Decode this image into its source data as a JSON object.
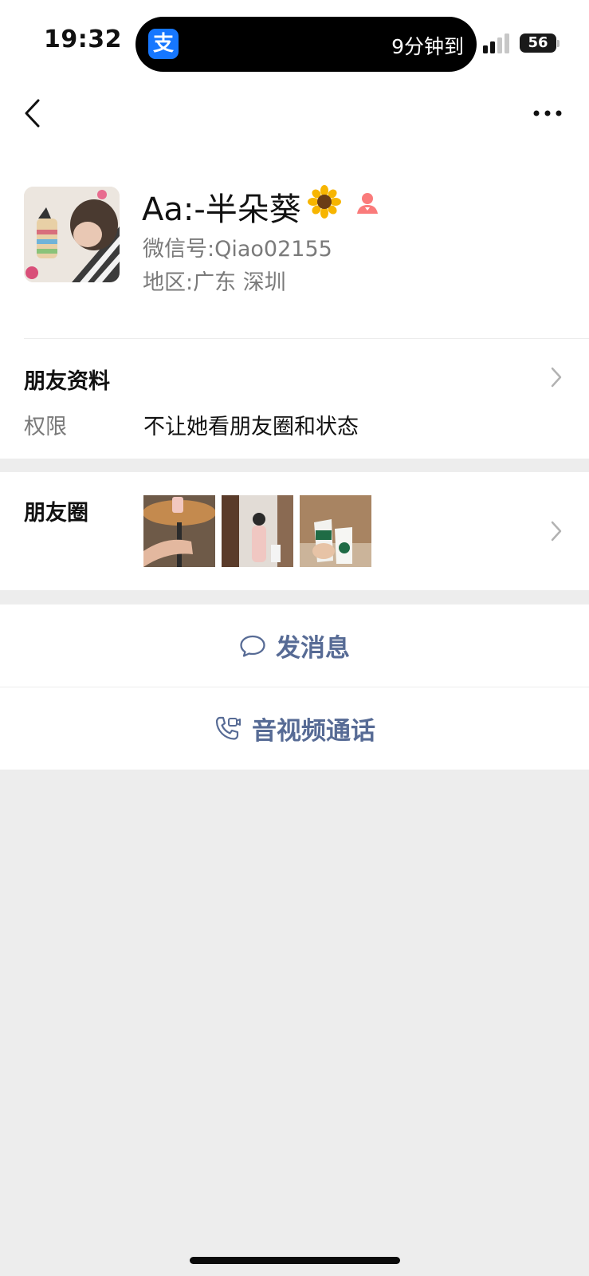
{
  "status_bar": {
    "time": "19:32",
    "island_app_icon": "alipay-icon",
    "island_app_glyph": "支",
    "island_text": "9分钟到",
    "battery": "56"
  },
  "nav": {
    "back_icon": "chevron-left-icon",
    "more_icon": "ellipsis-icon"
  },
  "profile": {
    "name": "Aa:-半朵葵",
    "name_emoji": "🌻",
    "gender_icon": "female-icon",
    "wechat_id_label": "微信号:",
    "wechat_id": "Qiao02155",
    "region_label": "地区:",
    "region": "广东 深圳"
  },
  "friend_info": {
    "title": "朋友资料",
    "permission_label": "权限",
    "permission_value": "不让她看朋友圈和状态"
  },
  "moments": {
    "title": "朋友圈"
  },
  "actions": {
    "message_label": "发消息",
    "call_label": "音视频通话"
  },
  "colors": {
    "link": "#576b95",
    "background": "#ededed",
    "gender_female": "#fa7b7b"
  }
}
